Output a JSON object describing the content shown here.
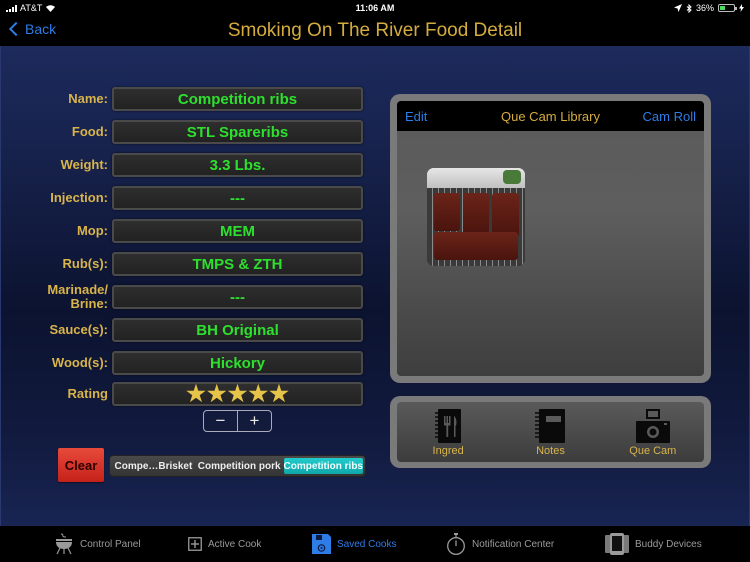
{
  "status_bar": {
    "carrier": "AT&T",
    "time": "11:06 AM",
    "battery_percent": "36%",
    "battery_level": 0.36
  },
  "nav": {
    "back_label": "Back",
    "title": "Smoking On The River Food Detail"
  },
  "fields": [
    {
      "label": "Name:",
      "value": "Competition ribs"
    },
    {
      "label": "Food:",
      "value": "STL Spareribs"
    },
    {
      "label": "Weight:",
      "value": "3.3 Lbs."
    },
    {
      "label": "Injection:",
      "value": "---"
    },
    {
      "label": "Mop:",
      "value": "MEM"
    },
    {
      "label": "Rub(s):",
      "value": "TMPS & ZTH"
    },
    {
      "label": "Marinade/ Brine:",
      "value": "---"
    },
    {
      "label": "Sauce(s):",
      "value": "BH Original"
    },
    {
      "label": "Wood(s):",
      "value": "Hickory"
    }
  ],
  "rating": {
    "label": "Rating",
    "stars": 5,
    "max_stars": 5,
    "star_glyph": "★",
    "decrement_label": "−",
    "increment_label": "+"
  },
  "clear_label": "Clear",
  "saved_items": {
    "options": [
      "Compe…Brisket",
      "Competition pork",
      "Competition ribs"
    ],
    "selected": "Competition ribs"
  },
  "library": {
    "edit_label": "Edit",
    "title": "Que Cam Library",
    "cam_roll_label": "Cam Roll",
    "photos": [
      {
        "subject": "smoked ribs on grill rack"
      }
    ]
  },
  "actions": [
    {
      "label": "Ingred",
      "icon": "recipe-book-icon"
    },
    {
      "label": "Notes",
      "icon": "notebook-icon"
    },
    {
      "label": "Que Cam",
      "icon": "camera-icon"
    }
  ],
  "tabs": [
    {
      "label": "Control Panel",
      "icon": "grill-icon",
      "active": false
    },
    {
      "label": "Active Cook",
      "icon": "plus-square-icon",
      "active": false
    },
    {
      "label": "Saved Cooks",
      "icon": "floppy-disk-icon",
      "active": true
    },
    {
      "label": "Notification Center",
      "icon": "stopwatch-icon",
      "active": false
    },
    {
      "label": "Buddy Devices",
      "icon": "devices-icon",
      "active": false
    }
  ],
  "colors": {
    "accent_blue": "#2e7ce6",
    "gold": "#d4ac3e",
    "value_green": "#2ee02e",
    "clear_red": "#d8322a",
    "selected_teal": "#18b8bc"
  }
}
